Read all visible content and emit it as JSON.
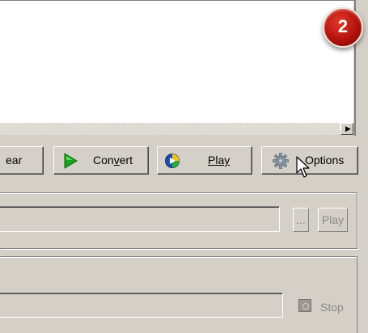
{
  "badge": {
    "number": "2"
  },
  "toolbar": {
    "clear_label": "ear",
    "convert_label": "Convert",
    "convert_mnemonic_index": 3,
    "play_label": "Play",
    "options_label": "Options"
  },
  "path_row": {
    "path_value": "",
    "browse_label": "...",
    "play_label": "Play"
  },
  "progress_row": {
    "stop_label": "Stop"
  },
  "icons": {
    "scroll_right": "right-arrow-icon",
    "convert": "green-play-triangle-icon",
    "play": "media-player-icon",
    "options": "gear-icon",
    "stop": "stop-icon",
    "cursor": "mouse-pointer-icon"
  },
  "colors": {
    "window_bg": "#d4d0c8",
    "badge_red": "#b3120c",
    "convert_green": "#1aa31a"
  }
}
